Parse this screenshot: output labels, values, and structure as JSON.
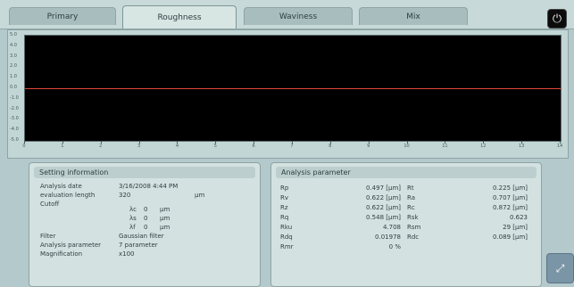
{
  "tabs": [
    {
      "label": "Primary",
      "active": false
    },
    {
      "label": "Roughness",
      "active": true
    },
    {
      "label": "Waviness",
      "active": false
    },
    {
      "label": "Mix",
      "active": false
    }
  ],
  "system_button_icon": "power-icon",
  "plot": {
    "background": "#000000",
    "trace_color": "#e0483c",
    "y_ticks": [
      "5.0",
      "4.0",
      "3.0",
      "2.0",
      "1.0",
      "0.0",
      "-1.0",
      "-2.0",
      "-3.0",
      "-4.0",
      "-5.0"
    ],
    "x_ticks": [
      "0",
      "1",
      "2",
      "3",
      "4",
      "5",
      "6",
      "7",
      "8",
      "9",
      "10",
      "11",
      "12",
      "13",
      "14"
    ],
    "trace_y_fraction": 0.5
  },
  "setting": {
    "title": "Setting information",
    "rows": {
      "analysis_date_label": "Analysis date",
      "analysis_date_value": "3/16/2008 4:44 PM",
      "eval_length_label": "evaluation length",
      "eval_length_value": "320",
      "eval_length_unit": "µm",
      "cutoff_label": "Cutoff",
      "cutoff_ac_label": "λc",
      "cutoff_ac_value": "0",
      "cutoff_ac_unit": "µm",
      "cutoff_as_label": "λs",
      "cutoff_as_value": "0",
      "cutoff_as_unit": "µm",
      "cutoff_af_label": "λf",
      "cutoff_af_value": "0",
      "cutoff_af_unit": "µm",
      "filter_label": "Filter",
      "filter_value": "Gaussian filter",
      "param_label": "Analysis parameter",
      "param_value": "7 parameter",
      "magnif_label": "Magnification",
      "magnif_value": "x100"
    }
  },
  "analysis": {
    "title": "Analysis parameter",
    "col1": [
      {
        "label": "Rp",
        "value": "0.497 [µm]"
      },
      {
        "label": "Rv",
        "value": "0.622 [µm]"
      },
      {
        "label": "Rz",
        "value": "0.622 [µm]"
      },
      {
        "label": "Rq",
        "value": "0.548 [µm]"
      },
      {
        "label": "Rku",
        "value": "4.708"
      },
      {
        "label": "Rdq",
        "value": "0.01978"
      },
      {
        "label": "Rmr",
        "value": "0 %"
      }
    ],
    "col2": [
      {
        "label": "Rt",
        "value": "0.225 [µm]"
      },
      {
        "label": "Ra",
        "value": "0.707 [µm]"
      },
      {
        "label": "Rc",
        "value": "0.872 [µm]"
      },
      {
        "label": "Rsk",
        "value": "0.623"
      },
      {
        "label": "Rsm",
        "value": "29 [µm]"
      },
      {
        "label": "Rdc",
        "value": "0.089 [µm]"
      }
    ]
  },
  "corner_button_icon": "resize-icon"
}
